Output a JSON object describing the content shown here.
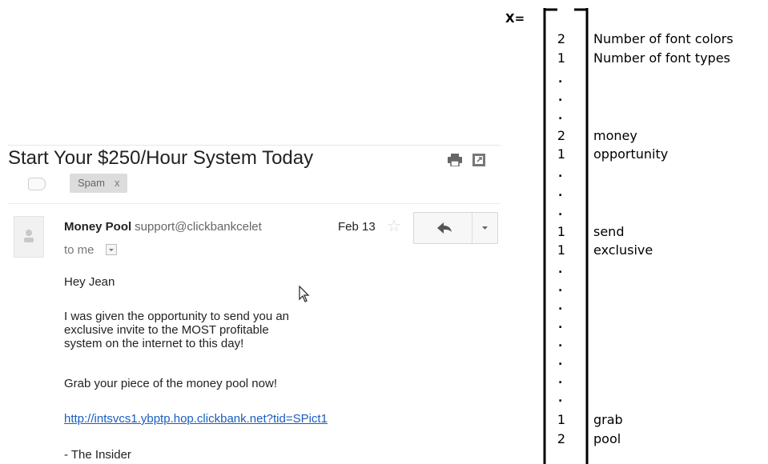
{
  "email": {
    "subject": "Start Your $250/Hour System Today",
    "label_chip": "Spam",
    "label_chip_close": "x",
    "sender_name": "Money Pool",
    "sender_email": "support@clickbankcelet",
    "date": "Feb 13",
    "to": "to me",
    "greeting": "Hey Jean",
    "paragraph1_line1": "I was given the opportunity to send you an",
    "paragraph1_line2": "exclusive invite to the MOST profitable",
    "paragraph1_line3": "system on the internet to this day!",
    "paragraph2": "Grab your piece of the money pool now!",
    "link": "http://intsvcs1.ybptp.hop.clickbank.net?tid=SPict1",
    "signoff": "- The Insider",
    "icons": [
      "print-icon",
      "new-window-icon",
      "label-icon",
      "avatar-icon",
      "star-icon",
      "reply-icon",
      "dropdown-icon",
      "cursor-icon"
    ]
  },
  "vector": {
    "name": "X=",
    "rows": [
      {
        "value": "2",
        "label": "Number of font colors"
      },
      {
        "value": "1",
        "label": "Number of font types"
      },
      {
        "value": "2",
        "label": "money"
      },
      {
        "value": "1",
        "label": "opportunity"
      },
      {
        "value": "1",
        "label": "send"
      },
      {
        "value": "1",
        "label": "exclusive"
      },
      {
        "value": "1",
        "label": "grab"
      },
      {
        "value": "2",
        "label": "pool"
      }
    ],
    "ellipsis": "."
  }
}
